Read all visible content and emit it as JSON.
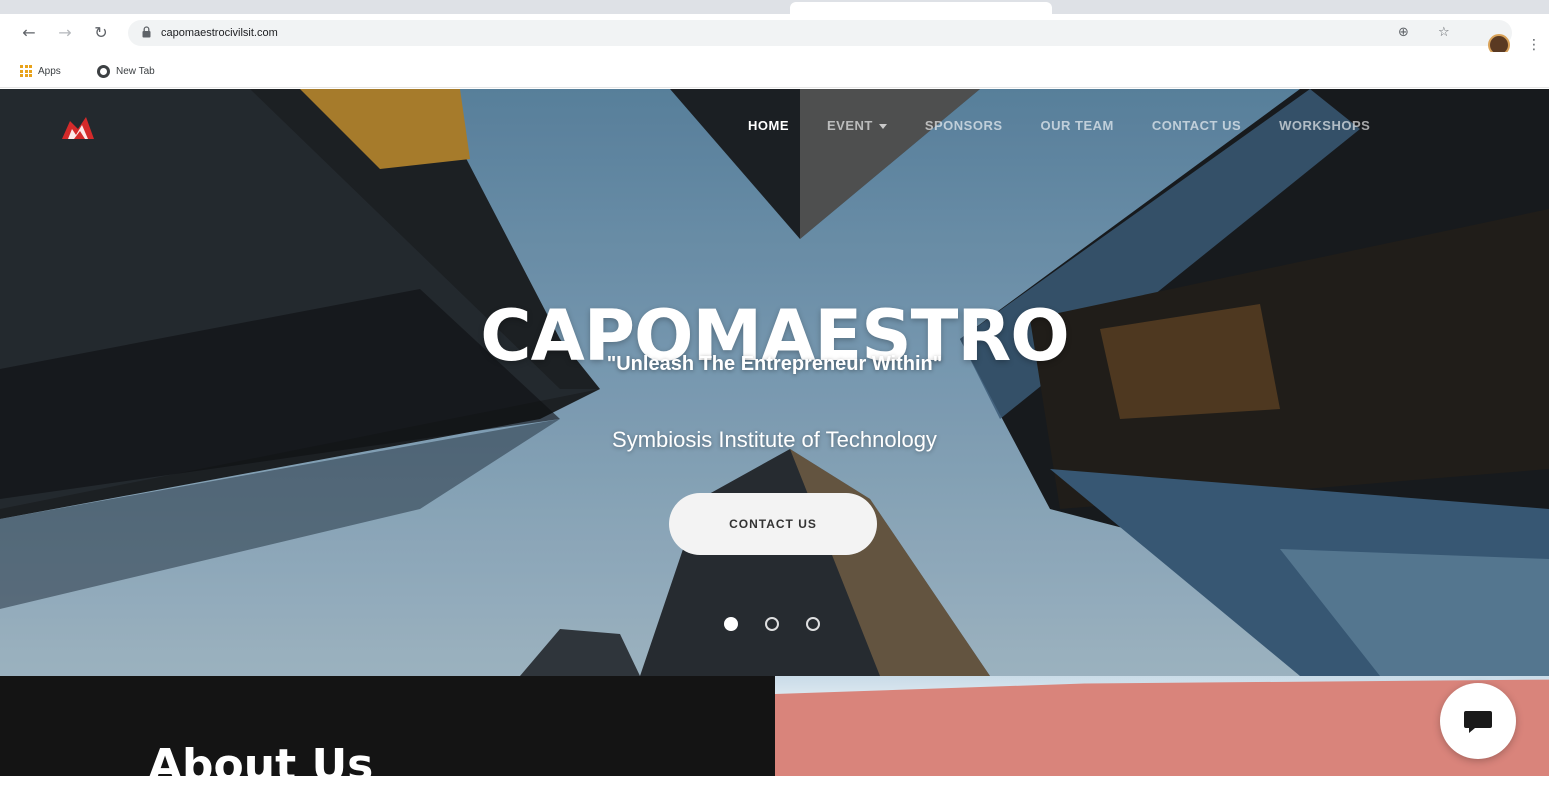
{
  "browser": {
    "url": "capomaestrocivilsit.com",
    "bookmarks": [
      {
        "label": "Apps",
        "icon": "apps-grid-icon"
      },
      {
        "label": "New Tab",
        "icon": "globe-icon"
      }
    ]
  },
  "site": {
    "nav": [
      {
        "label": "HOME",
        "active": true
      },
      {
        "label": "EVENT",
        "has_dropdown": true
      },
      {
        "label": "SPONSORS"
      },
      {
        "label": "OUR TEAM"
      },
      {
        "label": "CONTACT US"
      },
      {
        "label": "WORKSHOPS"
      }
    ],
    "hero": {
      "title": "CAPOMAESTRO",
      "tagline": "\"Unleash The Entrepreneur Within\"",
      "subtitle": "Symbiosis Institute of Technology",
      "cta": "CONTACT US",
      "slides": 3,
      "active_slide": 1
    },
    "about": {
      "heading": "About Us"
    }
  },
  "colors": {
    "logo_red": "#d42a2a",
    "about_bg": "#141414",
    "about_image_bg": "#d9847b"
  }
}
